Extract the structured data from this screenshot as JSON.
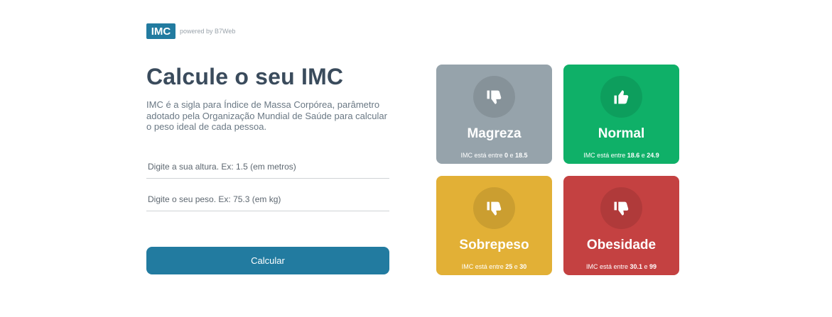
{
  "header": {
    "logo": "IMC",
    "powered_by": "powered by B7Web"
  },
  "main": {
    "title": "Calcule o seu IMC",
    "description": "IMC é a sigla para Índice de Massa Corpórea, parâmetro adotado pela Organização Mundial de Saúde para calcular o peso ideal de cada pessoa.",
    "altura_placeholder": "Digite a sua altura. Ex: 1.5 (em metros)",
    "peso_placeholder": "Digite o seu peso. Ex: 75.3 (em kg)",
    "button_label": "Calcular"
  },
  "cards": [
    {
      "title": "Magreza",
      "range_prefix": "IMC está entre ",
      "min": "0",
      "conj": " e ",
      "max": "18.5",
      "color": "#96a3ab",
      "icon": "thumbs-down-icon"
    },
    {
      "title": "Normal",
      "range_prefix": "IMC está entre ",
      "min": "18.6",
      "conj": " e ",
      "max": "24.9",
      "color": "#0fb068",
      "icon": "thumbs-up-icon"
    },
    {
      "title": "Sobrepeso",
      "range_prefix": "IMC está entre ",
      "min": "25",
      "conj": " e ",
      "max": "30",
      "color": "#e2b036",
      "icon": "thumbs-down-icon"
    },
    {
      "title": "Obesidade",
      "range_prefix": "IMC está entre ",
      "min": "30.1",
      "conj": " e ",
      "max": "99",
      "color": "#c44141",
      "icon": "thumbs-down-icon"
    }
  ],
  "colors": {
    "brand": "#227ba0",
    "text": "#3a4b5c"
  }
}
